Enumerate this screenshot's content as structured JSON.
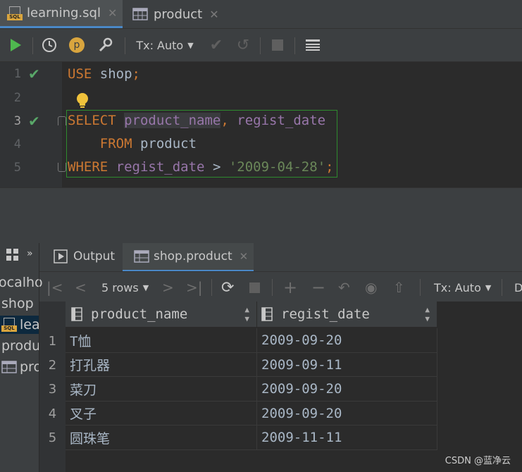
{
  "tabs": [
    {
      "label": "learning.sql",
      "icon": "sql-file-icon",
      "active": true
    },
    {
      "label": "product",
      "icon": "table-icon",
      "active": false
    }
  ],
  "toolbar": {
    "tx_mode": "Tx: Auto",
    "p_badge": "p"
  },
  "editor": {
    "line_numbers": [
      "1",
      "2",
      "3",
      "4",
      "5"
    ],
    "line1": {
      "kw": "USE",
      "name": "shop",
      "semi": ";"
    },
    "line3": {
      "kw": "SELECT",
      "col1": "product_name",
      "comma": ",",
      "col2": "regist_date"
    },
    "line4": {
      "kw": "FROM",
      "name": "product"
    },
    "line5": {
      "kw": "WHERE",
      "col": "regist_date",
      "op": ">",
      "str": "'2009-04-28'",
      "semi": ";"
    }
  },
  "services": {
    "items": [
      "ocalho",
      "shop",
      "lea",
      "produ",
      "pro"
    ]
  },
  "results": {
    "tabs": [
      {
        "label": "Output"
      },
      {
        "label": "shop.product"
      }
    ],
    "rows_label": "5 rows",
    "tx_mode": "Tx: Auto",
    "extra": "D",
    "columns": [
      "product_name",
      "regist_date"
    ],
    "rows": [
      {
        "n": "1",
        "product_name": "T恤",
        "regist_date": "2009-09-20"
      },
      {
        "n": "2",
        "product_name": "打孔器",
        "regist_date": "2009-09-11"
      },
      {
        "n": "3",
        "product_name": "菜刀",
        "regist_date": "2009-09-20"
      },
      {
        "n": "4",
        "product_name": "叉子",
        "regist_date": "2009-09-20"
      },
      {
        "n": "5",
        "product_name": "圆珠笔",
        "regist_date": "2009-11-11"
      }
    ]
  },
  "watermark": "CSDN @蓝净云"
}
